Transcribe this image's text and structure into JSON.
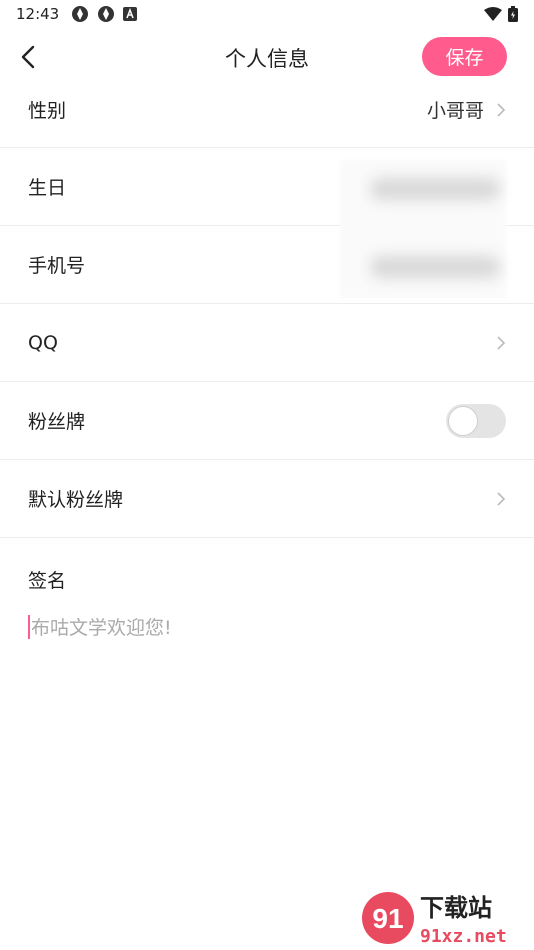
{
  "status_bar": {
    "time": "12:43"
  },
  "header": {
    "title": "个人信息",
    "save_label": "保存"
  },
  "rows": [
    {
      "label": "性别",
      "value": "小哥哥"
    },
    {
      "label": "生日",
      "value": ""
    },
    {
      "label": "手机号",
      "value": ""
    },
    {
      "label": "QQ",
      "value": ""
    },
    {
      "label": "粉丝牌",
      "toggle_on": false
    },
    {
      "label": "默认粉丝牌",
      "value": ""
    }
  ],
  "signature": {
    "label": "签名",
    "placeholder": "布咕文学欢迎您!"
  },
  "watermark": {
    "brand": "下载站",
    "url": "91xz.net",
    "logo_text": "91"
  },
  "colors": {
    "accent": "#ff5b8d",
    "divider": "#ececec",
    "placeholder": "#aaaaaa"
  }
}
